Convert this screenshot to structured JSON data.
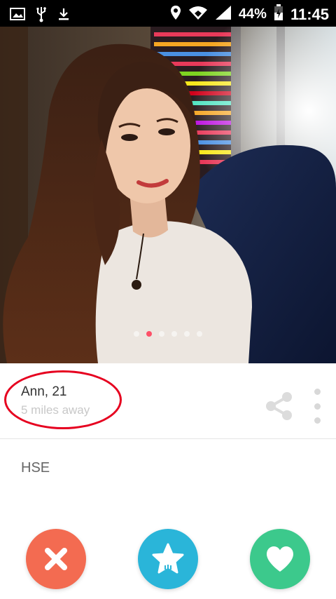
{
  "status_bar": {
    "icons_left": [
      "image-icon",
      "usb-icon",
      "download-icon"
    ],
    "icons_right": [
      "location-icon",
      "wifi-icon",
      "signal-icon",
      "battery-icon"
    ],
    "battery": "44%",
    "time": "11:45"
  },
  "profile": {
    "name_age": "Ann, 21",
    "distance": "5 miles away",
    "school": "HSE",
    "photo_index": 2,
    "photo_count": 6
  },
  "actions": [
    "nope",
    "super-like",
    "like"
  ],
  "colors": {
    "nope": "#f36b51",
    "super_like": "#2ab5d9",
    "like": "#3cc98c",
    "active_dot": "#fd5068",
    "annotation_ring": "#e6001f"
  }
}
